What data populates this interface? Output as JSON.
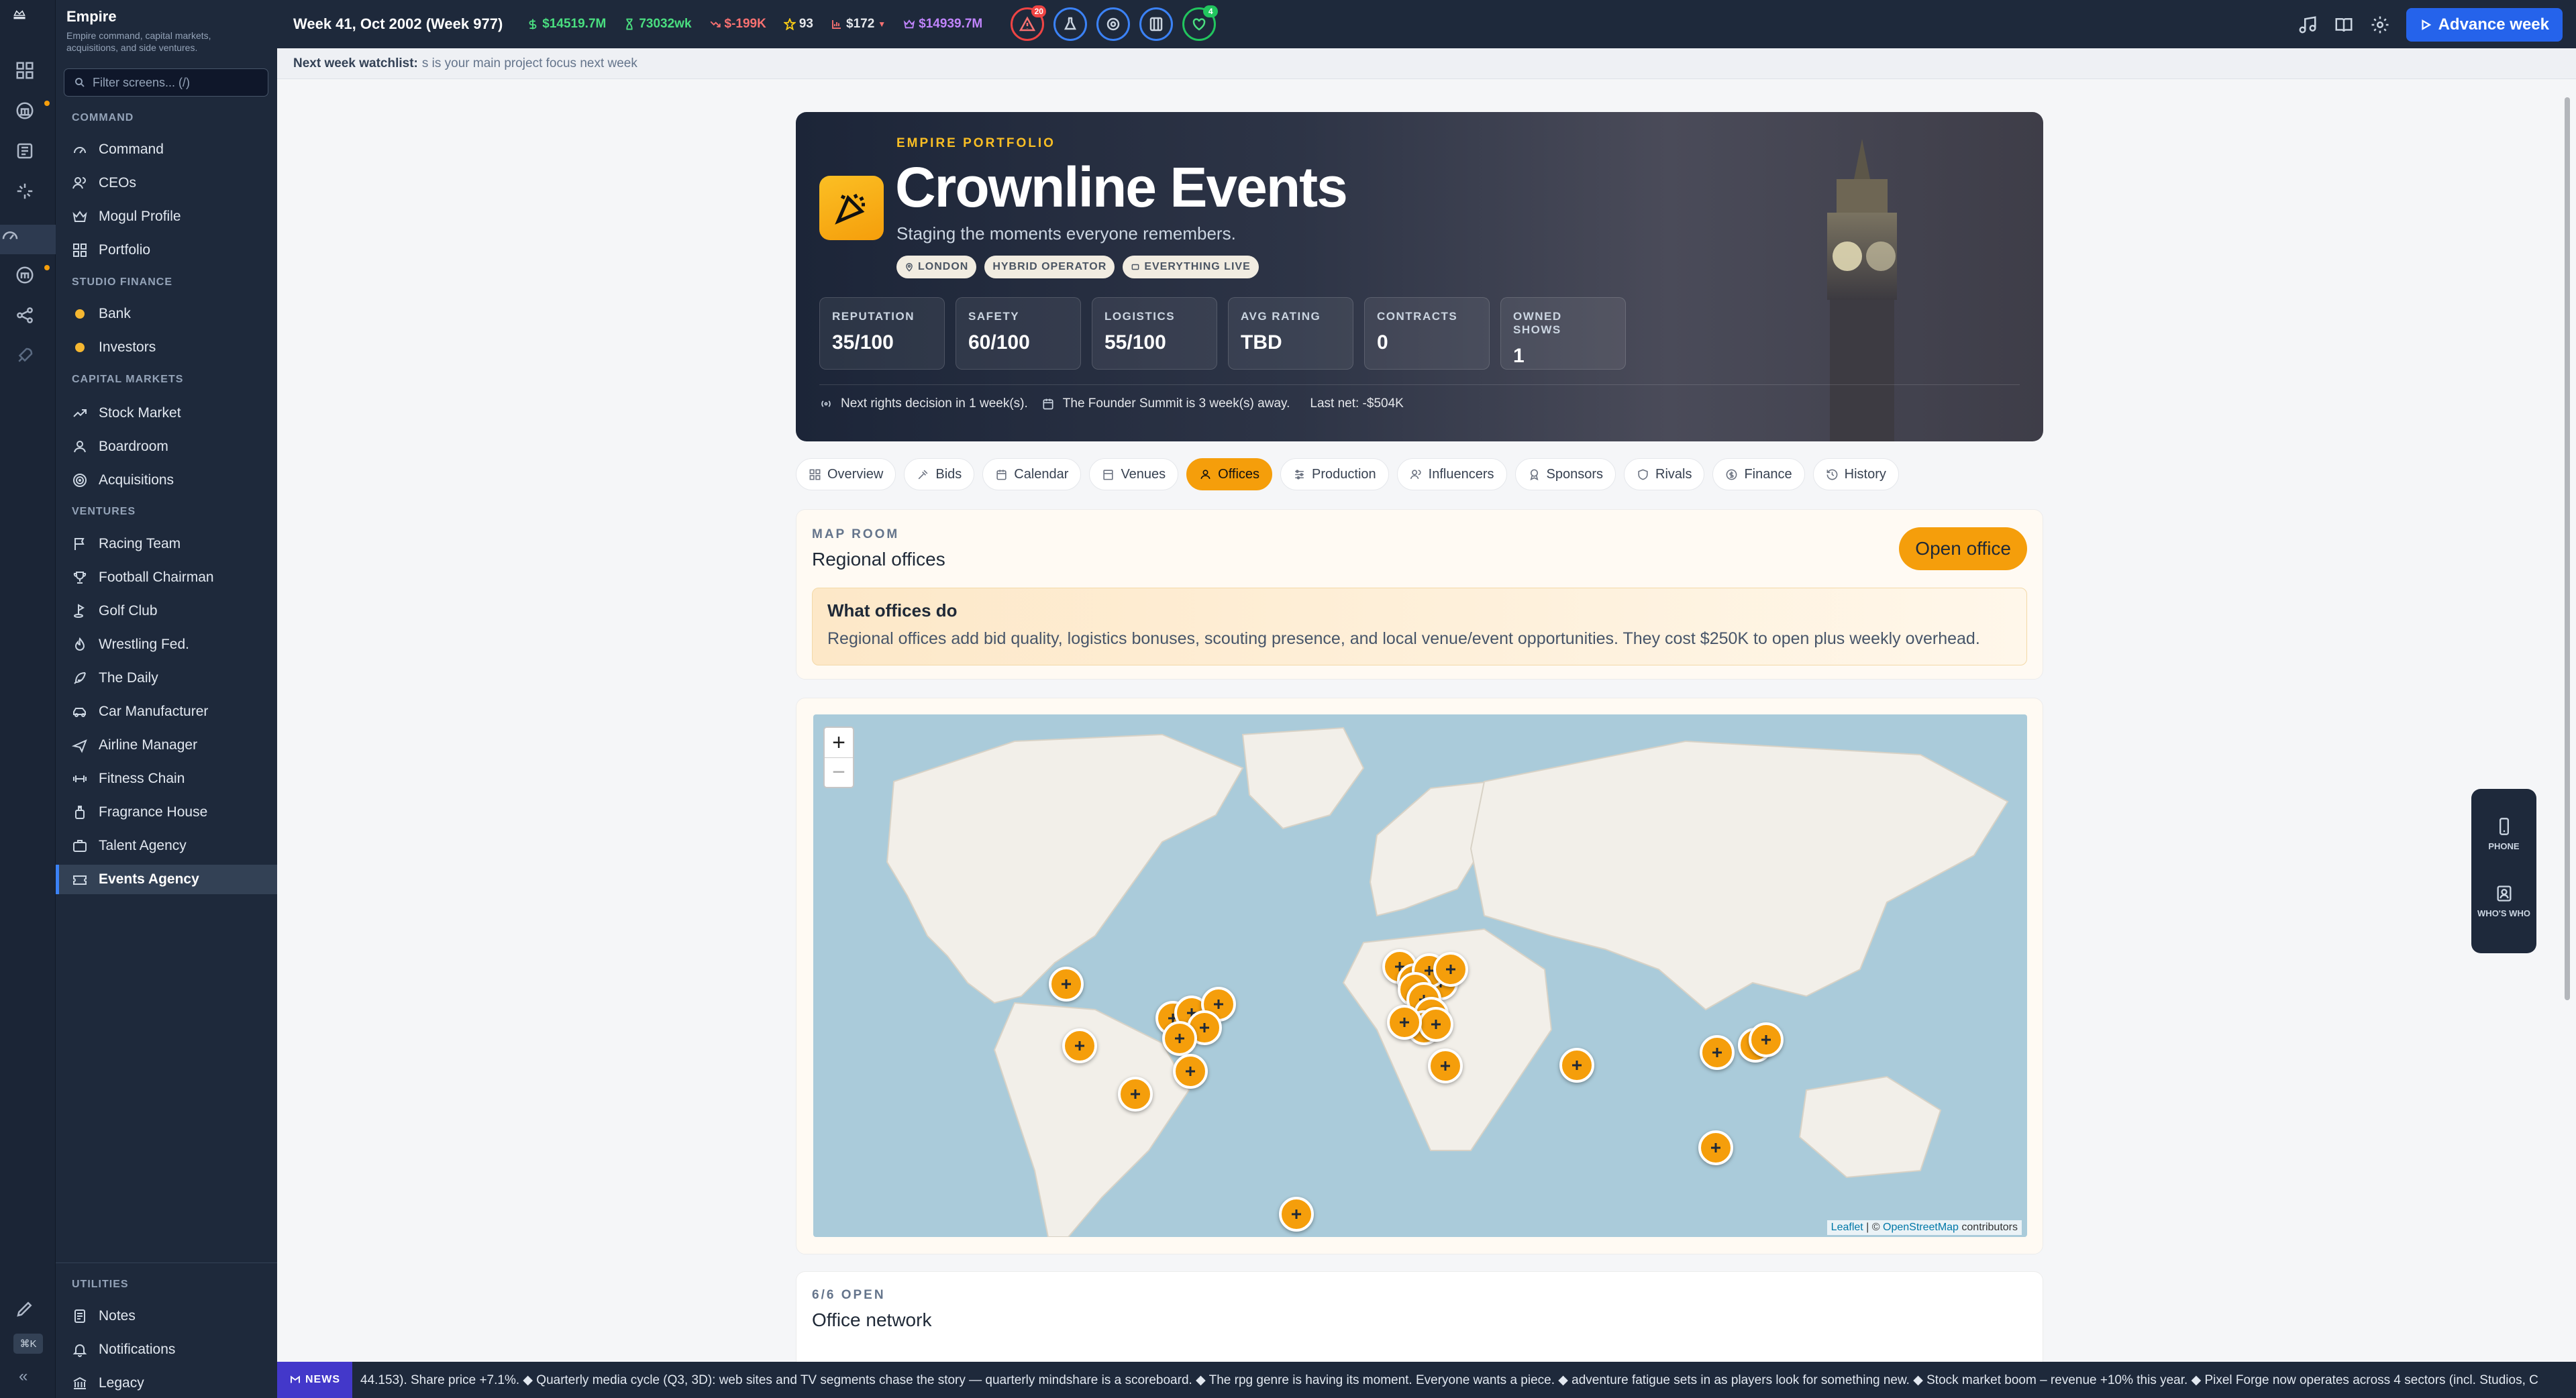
{
  "app": {
    "name": "Empire",
    "subtitle": "Empire command, capital markets, acquisitions, and side ventures."
  },
  "filter_placeholder": "Filter screens... (/)",
  "sidebar": {
    "sections": [
      {
        "title": "COMMAND",
        "items": [
          "Command",
          "CEOs",
          "Mogul Profile",
          "Portfolio"
        ]
      },
      {
        "title": "STUDIO FINANCE",
        "items": [
          "Bank",
          "Investors"
        ]
      },
      {
        "title": "CAPITAL MARKETS",
        "items": [
          "Stock Market",
          "Boardroom",
          "Acquisitions"
        ]
      },
      {
        "title": "VENTURES",
        "items": [
          "Racing Team",
          "Football Chairman",
          "Golf Club",
          "Wrestling Fed.",
          "The Daily",
          "Car Manufacturer",
          "Airline Manager",
          "Fitness Chain",
          "Fragrance House",
          "Talent Agency",
          "Events Agency"
        ]
      },
      {
        "title": "UTILITIES",
        "items": [
          "Notes",
          "Notifications",
          "Legacy"
        ]
      }
    ],
    "active": "Events Agency",
    "shortcut": "⌘K",
    "collapse": "«"
  },
  "topbar": {
    "week": "Week 41, Oct 2002 (Week 977)",
    "stats": [
      {
        "icon": "dollar-icon",
        "value": "$14519.7M",
        "color": "#4ade80"
      },
      {
        "icon": "hourglass-icon",
        "value": "73032wk",
        "color": "#4ade80"
      },
      {
        "icon": "trend-down-icon",
        "value": "$-199K",
        "color": "#f87171"
      },
      {
        "icon": "star-icon",
        "value": "93",
        "color": "#e5e7eb"
      },
      {
        "icon": "chart-icon",
        "value": "$172",
        "color": "#e5e7eb"
      },
      {
        "icon": "crown-icon",
        "value": "$14939.7M",
        "color": "#c084fc"
      }
    ],
    "alert_count": "20",
    "health_count": "4",
    "advance_label": "Advance week"
  },
  "watchlist": {
    "label": "Next week watchlist:",
    "text": "s is your main project focus next week"
  },
  "hero": {
    "eyebrow": "EMPIRE PORTFOLIO",
    "title": "Crownline Events",
    "subtitle": "Staging the moments everyone remembers.",
    "chips": [
      "LONDON",
      "HYBRID OPERATOR",
      "EVERYTHING LIVE"
    ],
    "stats": [
      {
        "label": "REPUTATION",
        "value": "35/100"
      },
      {
        "label": "SAFETY",
        "value": "60/100"
      },
      {
        "label": "LOGISTICS",
        "value": "55/100"
      },
      {
        "label": "AVG RATING",
        "value": "TBD"
      },
      {
        "label": "CONTRACTS",
        "value": "0"
      },
      {
        "label": "OWNED SHOWS",
        "value": "1"
      }
    ],
    "rights": "Next rights decision in 1 week(s).",
    "summit": "The Founder Summit is 3 week(s) away.",
    "lastnet": "Last net: -$504K"
  },
  "tabs": [
    "Overview",
    "Bids",
    "Calendar",
    "Venues",
    "Offices",
    "Production",
    "Influencers",
    "Sponsors",
    "Rivals",
    "Finance",
    "History"
  ],
  "active_tab": "Offices",
  "maproom": {
    "eyebrow": "MAP ROOM",
    "title": "Regional offices",
    "button": "Open office",
    "info_title": "What offices do",
    "info_text": "Regional offices add bid quality, logistics bonuses, scouting presence, and local venue/event opportunities. They cost $250K to open plus weekly overhead."
  },
  "map": {
    "zoom_in": "+",
    "zoom_out": "−",
    "attribution": {
      "leaflet": "Leaflet",
      "sep": " | © ",
      "osm": "OpenStreetMap",
      "tail": " contributors"
    }
  },
  "network": {
    "eyebrow": "6/6 OPEN",
    "title": "Office network"
  },
  "floating": {
    "phone": "PHONE",
    "whos_who": "WHO'S WHO"
  },
  "news": {
    "tag": "NEWS",
    "text": "44.153). Share price +7.1%. ◆ Quarterly media cycle (Q3, 3D): web sites and TV segments chase the story — quarterly mindshare is a scoreboard. ◆ The rpg genre is having its moment. Everyone wants a piece. ◆ adventure fatigue sets in as players look for something new. ◆ Stock market boom – revenue +10% this year. ◆ Pixel Forge now operates across 4 sectors (incl. Studios, C"
  }
}
